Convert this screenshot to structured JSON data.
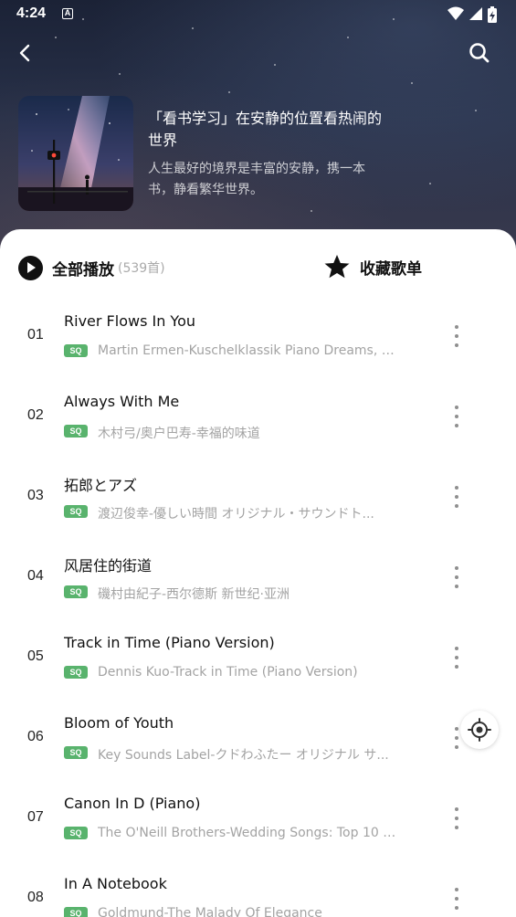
{
  "status_bar": {
    "time": "4:24",
    "notification_icon": "A",
    "icons": [
      "wifi-icon",
      "signal-icon",
      "battery-charging-icon"
    ]
  },
  "nav": {
    "back_icon": "chevron-left-icon",
    "search_icon": "search-icon"
  },
  "playlist": {
    "title": "「看书学习」在安静的位置看热闹的世界",
    "description": "人生最好的境界是丰富的安静，携一本书，静看繁华世界。"
  },
  "actions": {
    "play_all_label": "全部播放",
    "track_count": "(539首)",
    "collect_label": "收藏歌单"
  },
  "quality_badge": "SQ",
  "tracks": [
    {
      "num": "01",
      "title": "River Flows In You",
      "subtitle": "Martin Ermen-Kuschelklassik Piano Dreams, Vo..."
    },
    {
      "num": "02",
      "title": "Always With Me",
      "subtitle": "木村弓/奥户巴寿-幸福的味道"
    },
    {
      "num": "03",
      "title": "拓郎とアズ",
      "subtitle": "渡辺俊幸-優しい時間 オリジナル・サウンドト..."
    },
    {
      "num": "04",
      "title": "风居住的街道",
      "subtitle": "磯村由紀子-西尔德斯 新世纪·亚洲"
    },
    {
      "num": "05",
      "title": "Track in Time (Piano Version)",
      "subtitle": "Dennis Kuo-Track in Time (Piano Version)"
    },
    {
      "num": "06",
      "title": "Bloom of Youth",
      "subtitle": "Key Sounds Label-クドわふたー オリジナル サ..."
    },
    {
      "num": "07",
      "title": "Canon In D (Piano)",
      "subtitle": "The O'Neill Brothers-Wedding Songs: Top 10 W..."
    },
    {
      "num": "08",
      "title": "In A Notebook",
      "subtitle": "Goldmund-The Malady Of Elegance"
    }
  ],
  "colors": {
    "accent_green": "#59b36d",
    "header_dark": "#1b2236"
  }
}
